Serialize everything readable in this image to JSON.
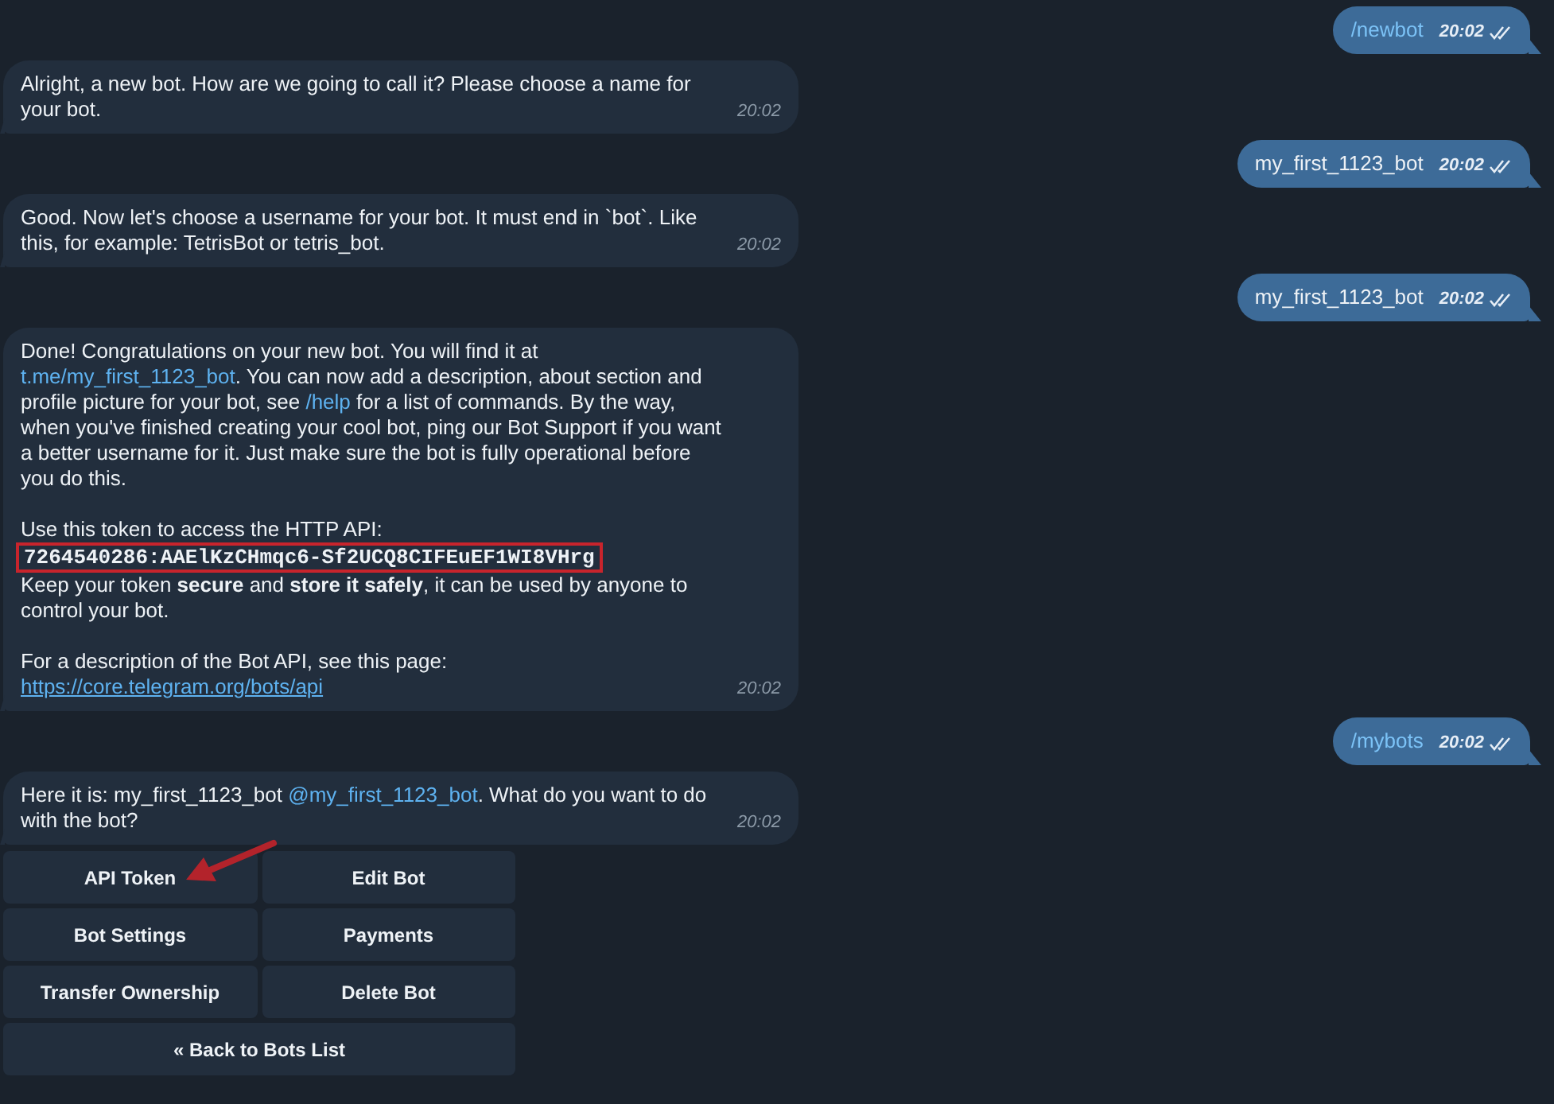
{
  "messages": [
    {
      "kind": "out",
      "time": "20:02",
      "paragraphs": [
        [
          {
            "kind": "text",
            "parts": [
              {
                "kind": "command",
                "text": "/newbot"
              }
            ]
          }
        ]
      ]
    },
    {
      "kind": "in",
      "time": "20:02",
      "paragraphs": [
        [
          {
            "kind": "text",
            "parts": [
              {
                "kind": "text",
                "text": "Alright, a new bot. How are we going to call it? Please choose a name for your bot."
              }
            ]
          }
        ]
      ]
    },
    {
      "kind": "out",
      "time": "20:02",
      "paragraphs": [
        [
          {
            "kind": "text",
            "parts": [
              {
                "kind": "text",
                "text": "my_first_1123_bot"
              }
            ]
          }
        ]
      ]
    },
    {
      "kind": "in",
      "time": "20:02",
      "paragraphs": [
        [
          {
            "kind": "text",
            "parts": [
              {
                "kind": "text",
                "text": "Good. Now let's choose a username for your bot. It must end in `bot`. Like this, for example: TetrisBot or tetris_bot."
              }
            ]
          }
        ]
      ]
    },
    {
      "kind": "out",
      "time": "20:02",
      "paragraphs": [
        [
          {
            "kind": "text",
            "parts": [
              {
                "kind": "text",
                "text": "my_first_1123_bot"
              }
            ]
          }
        ]
      ]
    },
    {
      "kind": "in",
      "time": "20:02",
      "paragraphs": [
        [
          {
            "kind": "text",
            "parts": [
              {
                "kind": "text",
                "text": "Done! Congratulations on your new bot. You will find it at "
              },
              {
                "kind": "link",
                "text": "t.me/my_first_1123_bot"
              },
              {
                "kind": "text",
                "text": ". You can now add a description, about section and profile picture for your bot, see "
              },
              {
                "kind": "command",
                "text": "/help"
              },
              {
                "kind": "text",
                "text": " for a list of commands. By the way, when you've finished creating your cool bot, ping our Bot Support if you want a better username for it. Just make sure the bot is fully operational before you do this."
              }
            ]
          }
        ],
        [
          {
            "kind": "text",
            "parts": [
              {
                "kind": "text",
                "text": "Use this token to access the HTTP API:"
              }
            ]
          },
          {
            "kind": "token",
            "text": "7264540286:AAElKzCHmqc6-Sf2UCQ8CIFEuEF1WI8VHrg",
            "highlighted": true
          },
          {
            "kind": "text",
            "parts": [
              {
                "kind": "text",
                "text": "Keep your token **secure** and **store it safely**, it can be used by anyone to control your bot."
              }
            ]
          }
        ],
        [
          {
            "kind": "text",
            "parts": [
              {
                "kind": "text",
                "text": "For a description of the Bot API, see this page: "
              },
              {
                "kind": "url",
                "text": "https://core.telegram.org/bots/api"
              }
            ]
          }
        ]
      ]
    },
    {
      "kind": "out",
      "time": "20:02",
      "paragraphs": [
        [
          {
            "kind": "text",
            "parts": [
              {
                "kind": "command",
                "text": "/mybots"
              }
            ]
          }
        ]
      ]
    },
    {
      "kind": "in",
      "time": "20:02",
      "paragraphs": [
        [
          {
            "kind": "text",
            "parts": [
              {
                "kind": "text",
                "text": "Here it is: my_first_1123_bot "
              },
              {
                "kind": "link",
                "text": "@my_first_1123_bot"
              },
              {
                "kind": "text",
                "text": ". What do you want to do with the bot?"
              }
            ]
          }
        ]
      ],
      "keyboard": [
        [
          {
            "label": "API Token",
            "pointed": true
          },
          {
            "label": "Edit Bot",
            "pointed": false
          }
        ],
        [
          {
            "label": "Bot Settings",
            "pointed": false
          },
          {
            "label": "Payments",
            "pointed": false
          }
        ],
        [
          {
            "label": "Transfer Ownership",
            "pointed": false
          },
          {
            "label": "Delete Bot",
            "pointed": false
          }
        ],
        [
          {
            "label": "« Back to Bots List",
            "pointed": false
          }
        ]
      ]
    }
  ]
}
